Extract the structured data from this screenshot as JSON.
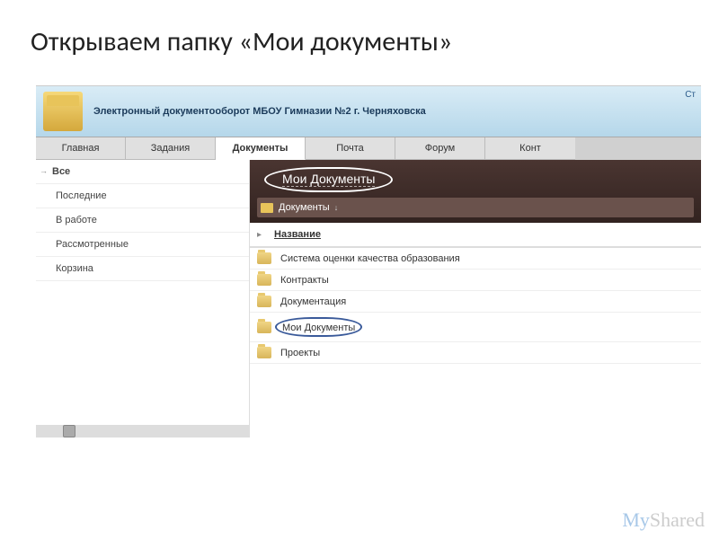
{
  "slide": {
    "title": "Открываем папку «Мои документы»"
  },
  "header": {
    "title": "Электронный документооборот МБОУ Гимназии №2 г. Черняховска",
    "side": "Ст"
  },
  "tabs": [
    {
      "label": "Главная"
    },
    {
      "label": "Задания"
    },
    {
      "label": "Документы"
    },
    {
      "label": "Почта"
    },
    {
      "label": "Форум"
    },
    {
      "label": "Конт"
    }
  ],
  "sidebar": [
    {
      "label": "Все"
    },
    {
      "label": "Последние"
    },
    {
      "label": "В работе"
    },
    {
      "label": "Рассмотренные"
    },
    {
      "label": "Корзина"
    }
  ],
  "main": {
    "title": "Мои Документы",
    "breadcrumb": "Документы",
    "column_header": "Название",
    "rows": [
      {
        "label": "Система оценки качества образования"
      },
      {
        "label": "Контракты"
      },
      {
        "label": "Документация"
      },
      {
        "label": "Мои Документы"
      },
      {
        "label": "Проекты"
      }
    ]
  },
  "watermark": {
    "a": "My",
    "b": "Shared"
  }
}
